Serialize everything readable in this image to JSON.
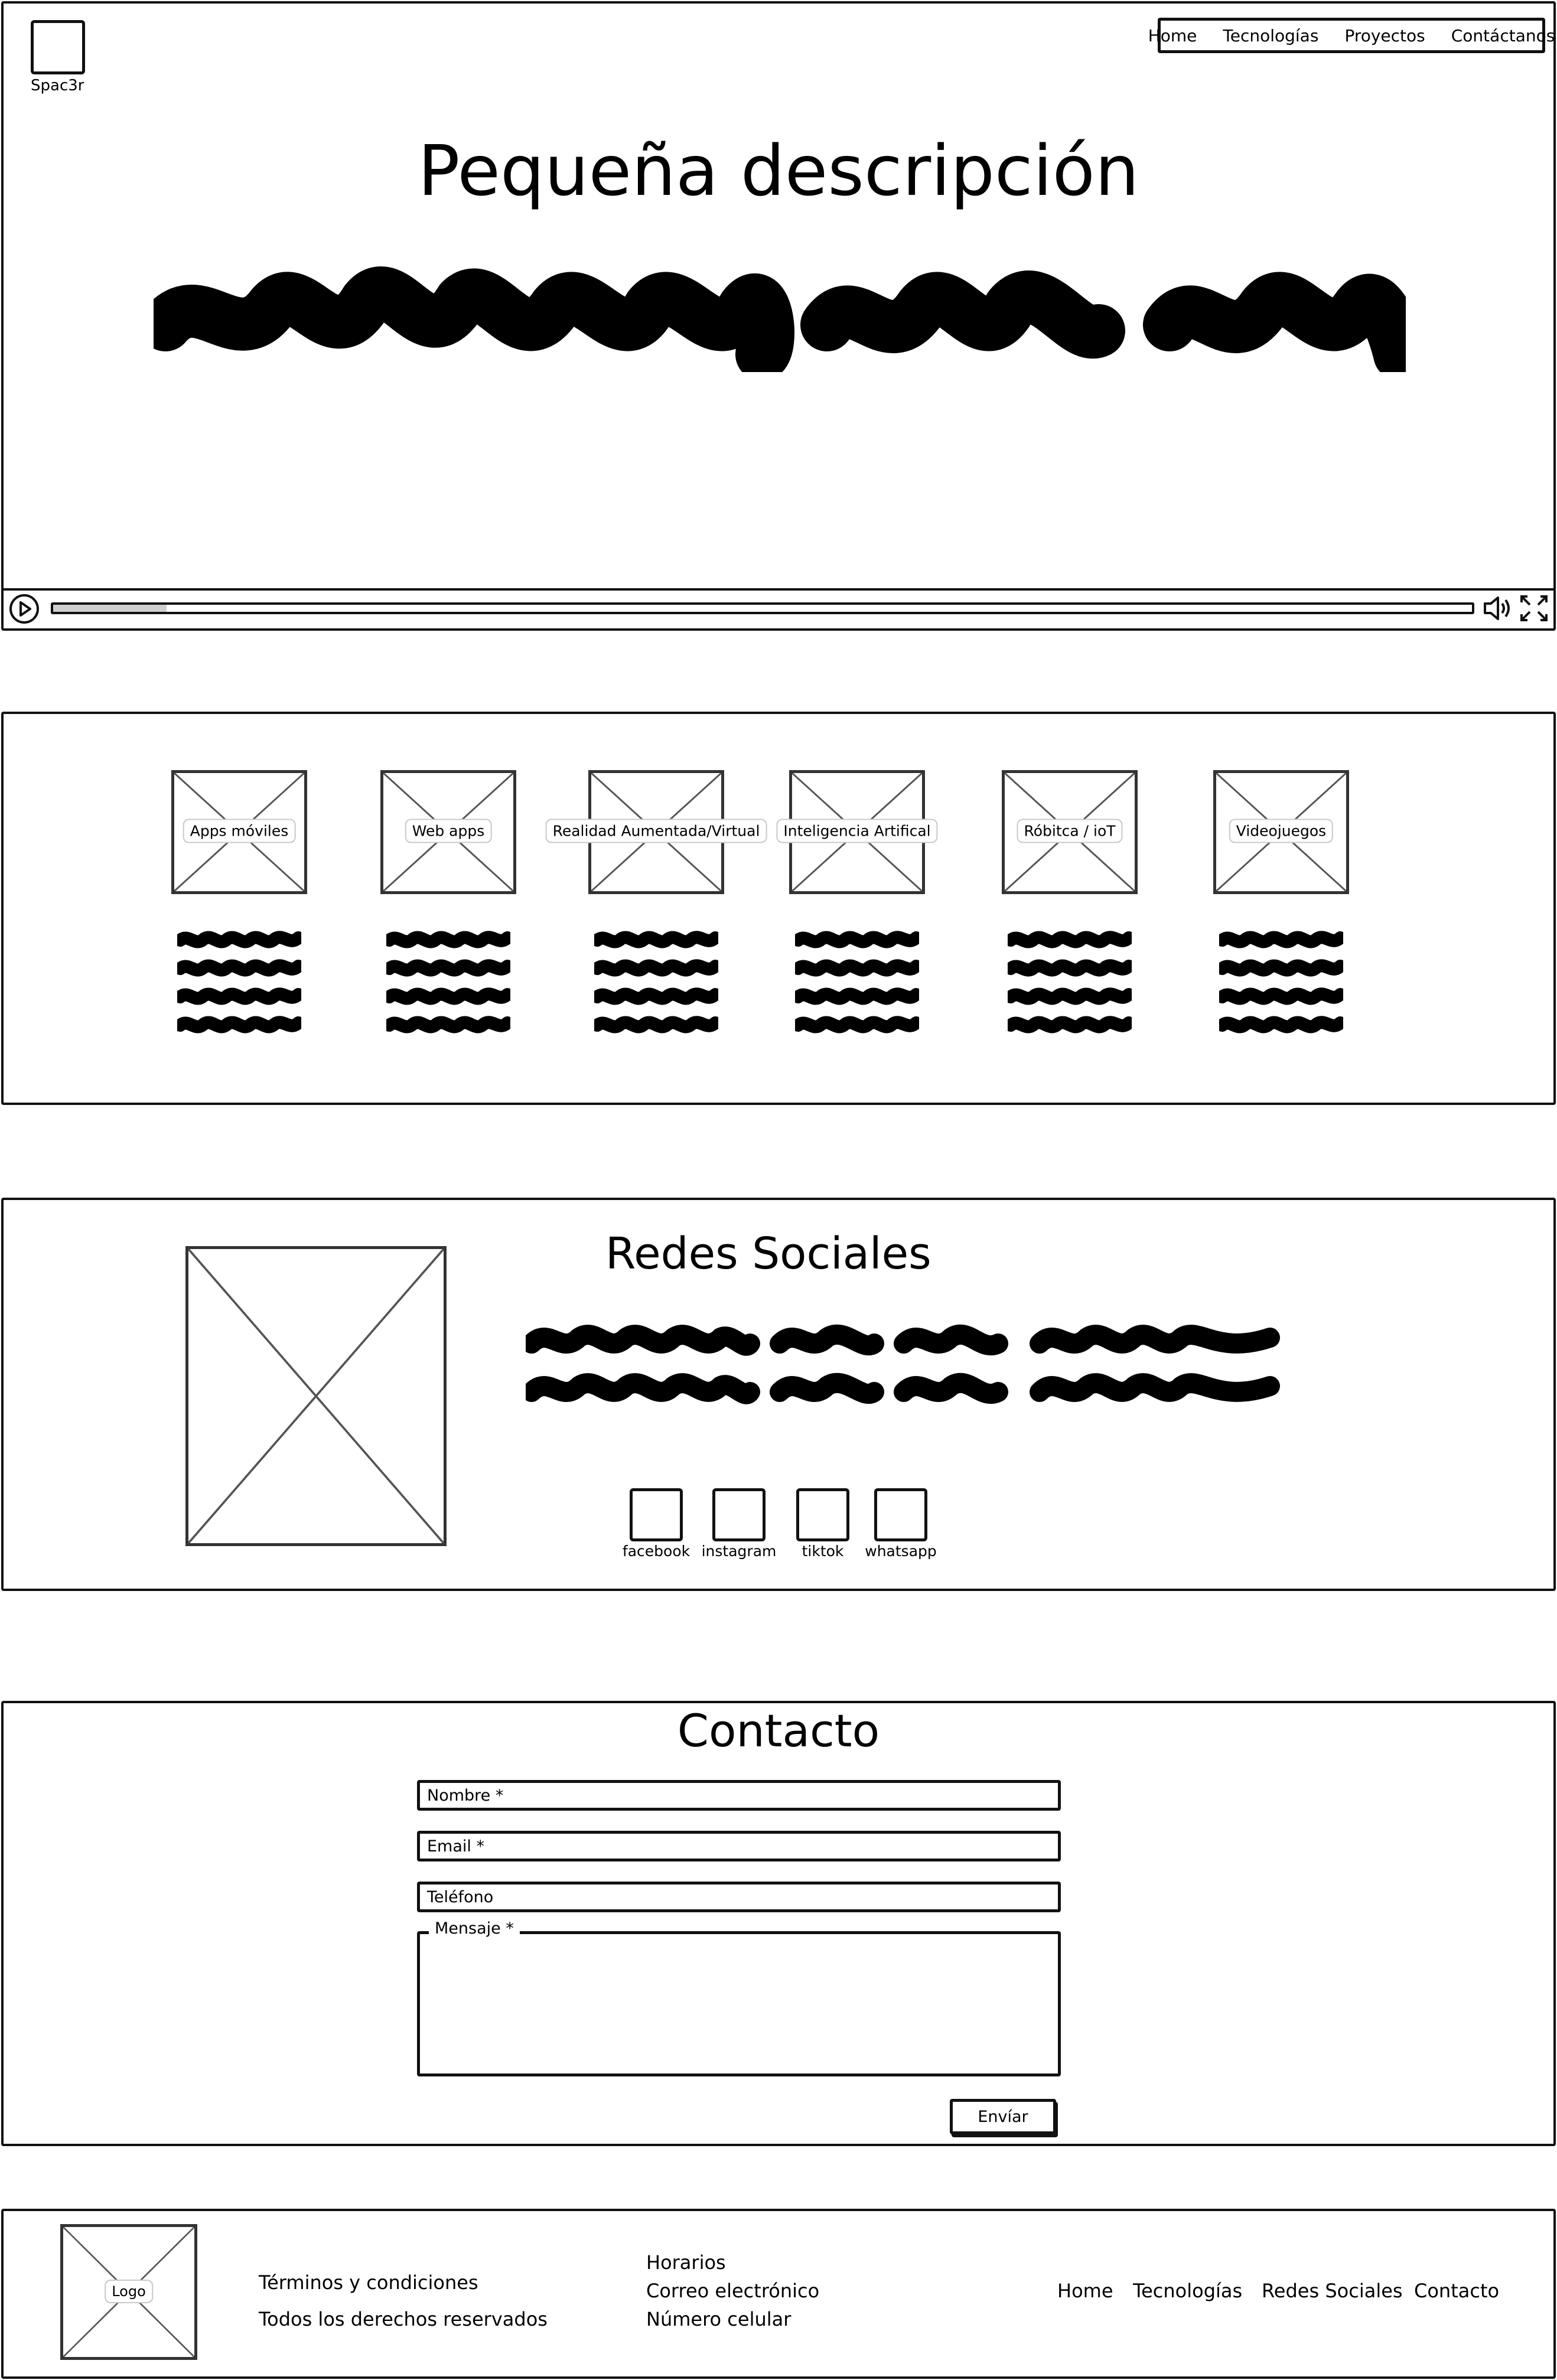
{
  "brand": {
    "name": "Spac3r"
  },
  "nav": {
    "items": [
      "Home",
      "Tecnologías",
      "Proyectos",
      "Contáctanos"
    ]
  },
  "hero": {
    "title": "Pequeña descripción",
    "video_progress": 0.08
  },
  "tech": {
    "items": [
      "Apps móviles",
      "Web apps",
      "Realidad Aumentada/Virtual",
      "Inteligencia Artifical",
      "Róbitca / ioT",
      "Videojuegos"
    ]
  },
  "social": {
    "title": "Redes Sociales",
    "links": [
      "facebook",
      "instagram",
      "tiktok",
      "whatsapp"
    ]
  },
  "contact": {
    "title": "Contacto",
    "name_label": "Nombre *",
    "email_label": "Email *",
    "phone_label": "Teléfono",
    "message_label": "Mensaje *",
    "submit": "Envíar"
  },
  "footer": {
    "logo": "Logo",
    "terms": "Términos y condiciones",
    "rights": "Todos los derechos reservados",
    "hours": "Horarios",
    "email": "Correo electrónico",
    "phone": "Número celular",
    "links": [
      "Home",
      "Tecnologías",
      "Redes Sociales",
      "Contacto"
    ]
  },
  "colors": {
    "ink": "#111111",
    "progress": "#cfcfcf",
    "image_cross": "#555555"
  }
}
